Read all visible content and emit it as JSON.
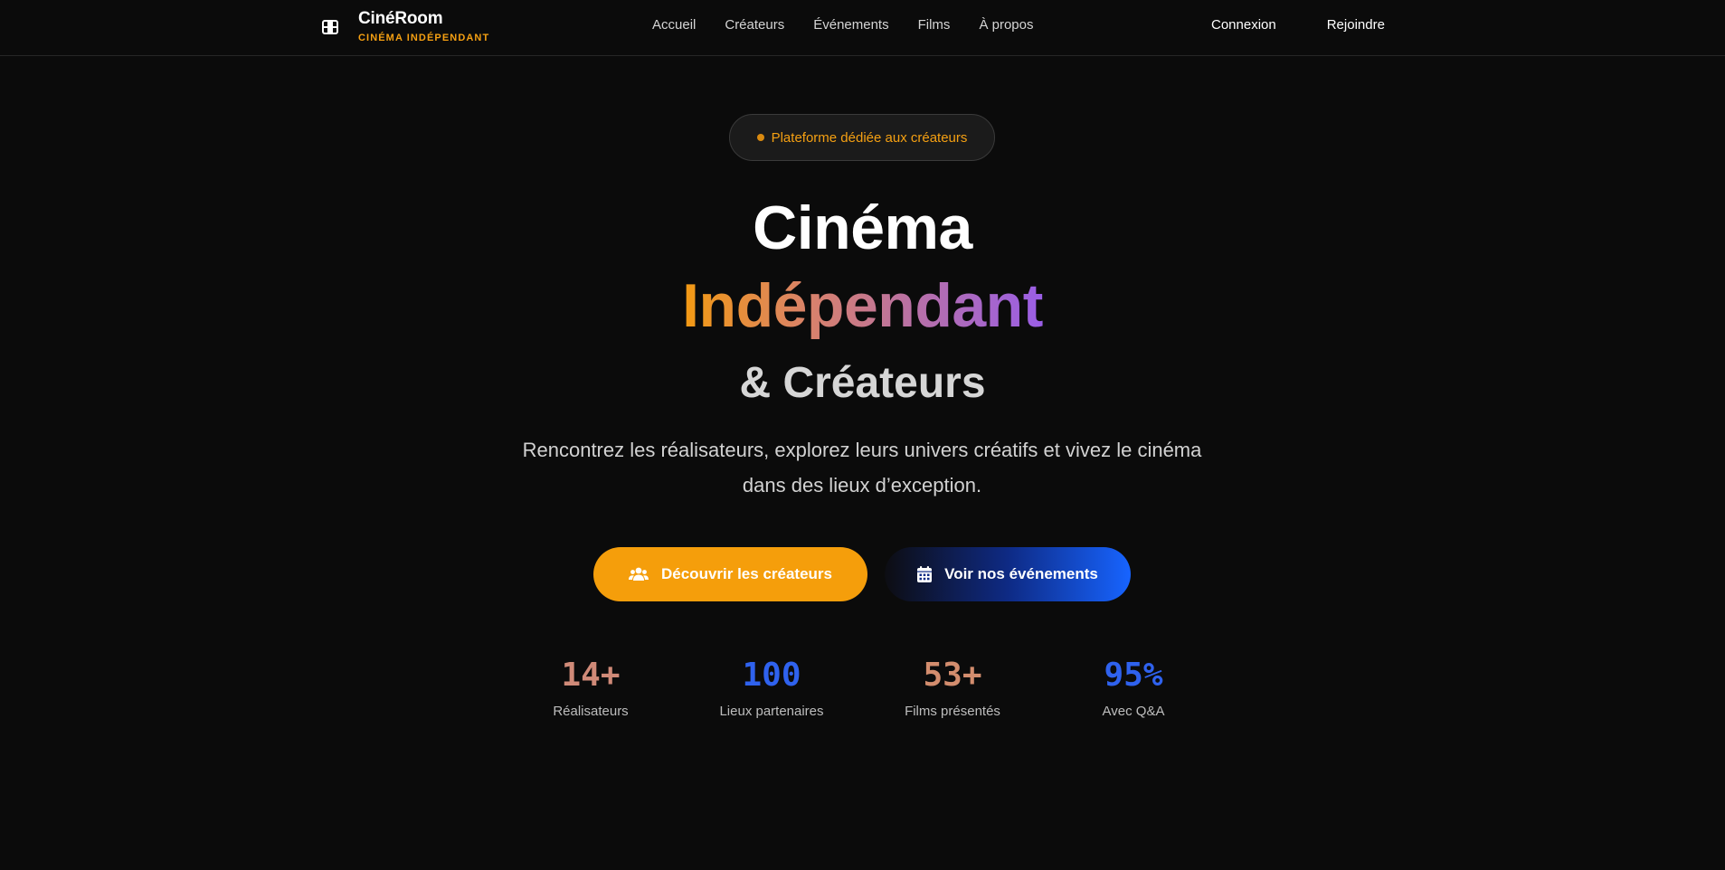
{
  "brand": {
    "name": "CinéRoom",
    "tagline": "CINÉMA INDÉPENDANT",
    "icon": "film-icon"
  },
  "nav": {
    "links": [
      "Accueil",
      "Créateurs",
      "Événements",
      "Films",
      "À propos"
    ],
    "login": "Connexion",
    "join": "Rejoindre"
  },
  "hero": {
    "badge": "Plateforme dédiée aux créateurs",
    "title_line1": "Cinéma",
    "title_line2": "Indépendant",
    "title_line3": "& Créateurs",
    "lead": "Rencontrez les réalisateurs, explorez leurs univers créatifs et vivez le cinéma dans des lieux d’exception.",
    "primary_cta": {
      "label": "Découvrir les créateurs",
      "icon": "users-icon"
    },
    "secondary_cta": {
      "label": "Voir nos événements",
      "icon": "calendar-icon"
    }
  },
  "stats": [
    {
      "value": "14+",
      "label": "Réalisateurs"
    },
    {
      "value": "100",
      "label": "Lieux partenaires"
    },
    {
      "value": "53+",
      "label": "Films présentés"
    },
    {
      "value": "95%",
      "label": "Avec Q&A"
    }
  ],
  "colors": {
    "background": "#0b0b0b",
    "accent_orange": "#f59e0b",
    "accent_blue": "#1764ff",
    "accent_purple": "#9a5ee6"
  }
}
